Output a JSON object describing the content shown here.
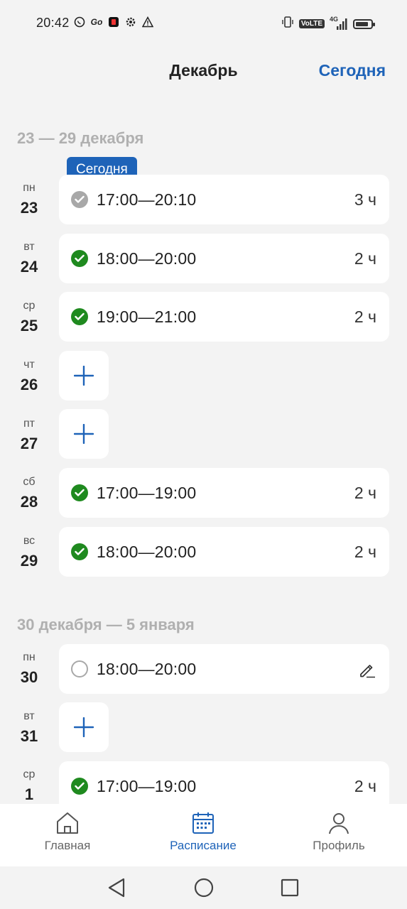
{
  "status_bar": {
    "time": "20:42",
    "left_icons": [
      "whatsapp-icon",
      "go-icon",
      "app-icon",
      "gear-icon",
      "warning-icon"
    ],
    "volte": "VoLTE",
    "network": "4G",
    "right_icons": [
      "vibrate-icon",
      "volte-icon",
      "signal-icon",
      "battery-icon"
    ]
  },
  "header": {
    "title": "Декабрь",
    "today_button": "Сегодня"
  },
  "accent_color": "#1e63b8",
  "done_color": "#1f8a1f",
  "today_badge": "Сегодня",
  "weeks": [
    {
      "title": "23 — 29 декабря",
      "days": [
        {
          "weekday": "пн",
          "number": "23",
          "time": "17:00—20:10",
          "duration": "3 ч",
          "status": "past"
        },
        {
          "weekday": "вт",
          "number": "24",
          "time": "18:00—20:00",
          "duration": "2 ч",
          "status": "done"
        },
        {
          "weekday": "ср",
          "number": "25",
          "time": "19:00—21:00",
          "duration": "2 ч",
          "status": "done"
        },
        {
          "weekday": "чт",
          "number": "26",
          "add": "+"
        },
        {
          "weekday": "пт",
          "number": "27",
          "add": "+"
        },
        {
          "weekday": "сб",
          "number": "28",
          "time": "17:00—19:00",
          "duration": "2 ч",
          "status": "done"
        },
        {
          "weekday": "вс",
          "number": "29",
          "time": "18:00—20:00",
          "duration": "2 ч",
          "status": "done"
        }
      ]
    },
    {
      "title": "30 декабря — 5 января",
      "days": [
        {
          "weekday": "пн",
          "number": "30",
          "time": "18:00—20:00",
          "status": "planned",
          "action": "edit-icon"
        },
        {
          "weekday": "вт",
          "number": "31",
          "add": "+"
        },
        {
          "weekday": "ср",
          "number": "1",
          "time": "17:00—19:00",
          "duration": "2 ч",
          "status": "done"
        }
      ]
    }
  ],
  "bottom_nav": {
    "items": [
      {
        "label": "Главная",
        "icon": "home-icon",
        "active": false
      },
      {
        "label": "Расписание",
        "icon": "calendar-icon",
        "active": true
      },
      {
        "label": "Профиль",
        "icon": "profile-icon",
        "active": false
      }
    ]
  },
  "system_nav": [
    "back-icon",
    "home-circle-icon",
    "recents-icon"
  ]
}
